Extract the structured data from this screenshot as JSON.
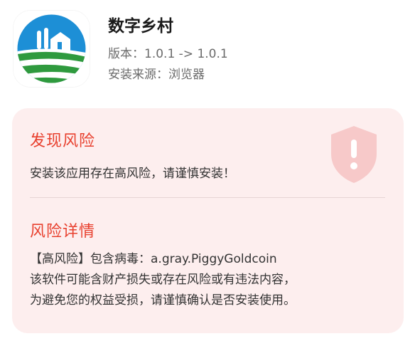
{
  "app": {
    "name": "数字乡村",
    "version_line": "版本：1.0.1 -> 1.0.1",
    "source_line": "安装来源：浏览器",
    "icon": "farm-landscape-icon"
  },
  "risk": {
    "found_title": "发现风险",
    "found_message": "安装该应用存在高风险，请谨慎安装！",
    "shield_icon": "warning-shield-icon",
    "detail_title": "风险详情",
    "detail_lines": [
      "【高风险】包含病毒：a.gray.PiggyGoldcoin",
      "该软件可能含财产损失或存在风险或有违法内容，",
      "为避免您的权益受损，请谨慎确认是否安装使用。"
    ]
  },
  "colors": {
    "danger": "#e8402e",
    "card_background": "#fdeeee",
    "shield": "#f7c9c9"
  }
}
